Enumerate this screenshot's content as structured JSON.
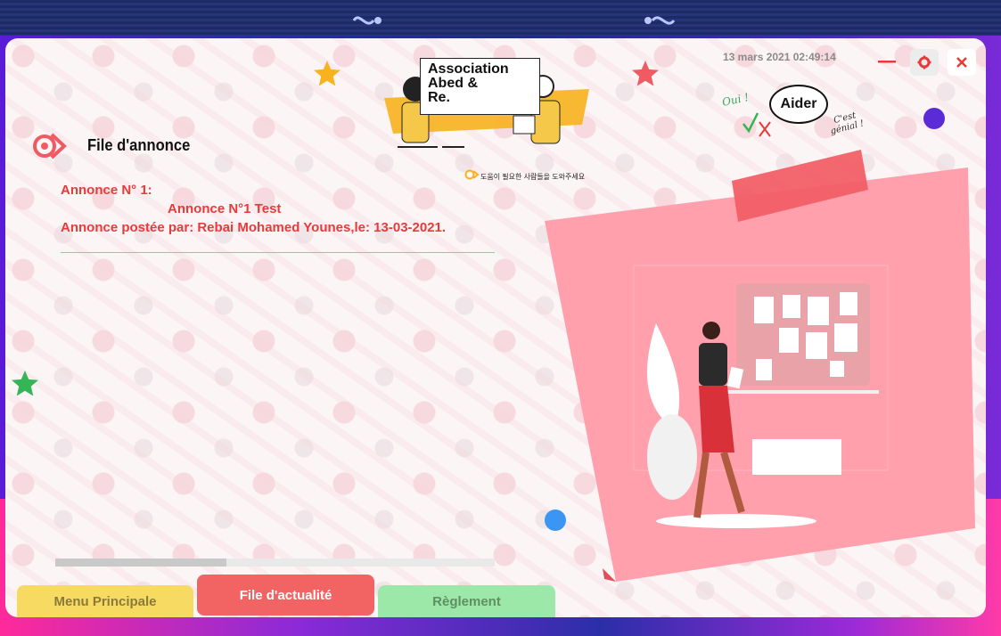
{
  "window": {
    "datetime": "13 mars 2021 02:49:14",
    "controls": {
      "minimize_icon": "minimize-icon",
      "settings_icon": "gear-icon",
      "close_icon": "close-icon"
    }
  },
  "logo": {
    "title_lines": [
      "Association",
      "Abed &",
      "Re."
    ],
    "tagline": "도움이 필요한 사람들을 도와주세요"
  },
  "page": {
    "title": "File d'annonce",
    "icon": "target-icon"
  },
  "announcement": {
    "heading": "Annonce N° 1:",
    "title": "Annonce N°1 Test",
    "meta": "Annonce postée par: Rebai Mohamed Younes,le: 13-03-2021."
  },
  "help": {
    "label": "Aider",
    "yes_note": "Oui !",
    "great_note_lines": [
      "C'est",
      "génial !"
    ]
  },
  "scroll": {
    "position": 0.39
  },
  "tabs": [
    {
      "label": "Menu Principale",
      "color": "#f7da62",
      "active": false
    },
    {
      "label": "File d'actualité",
      "color": "#f26464",
      "active": true
    },
    {
      "label": "Règlement",
      "color": "#9ce8a8",
      "active": false
    }
  ],
  "colors": {
    "accent_red": "#e93a3a",
    "note_pink": "#ffa0ac",
    "tape_red": "#f25f67"
  }
}
